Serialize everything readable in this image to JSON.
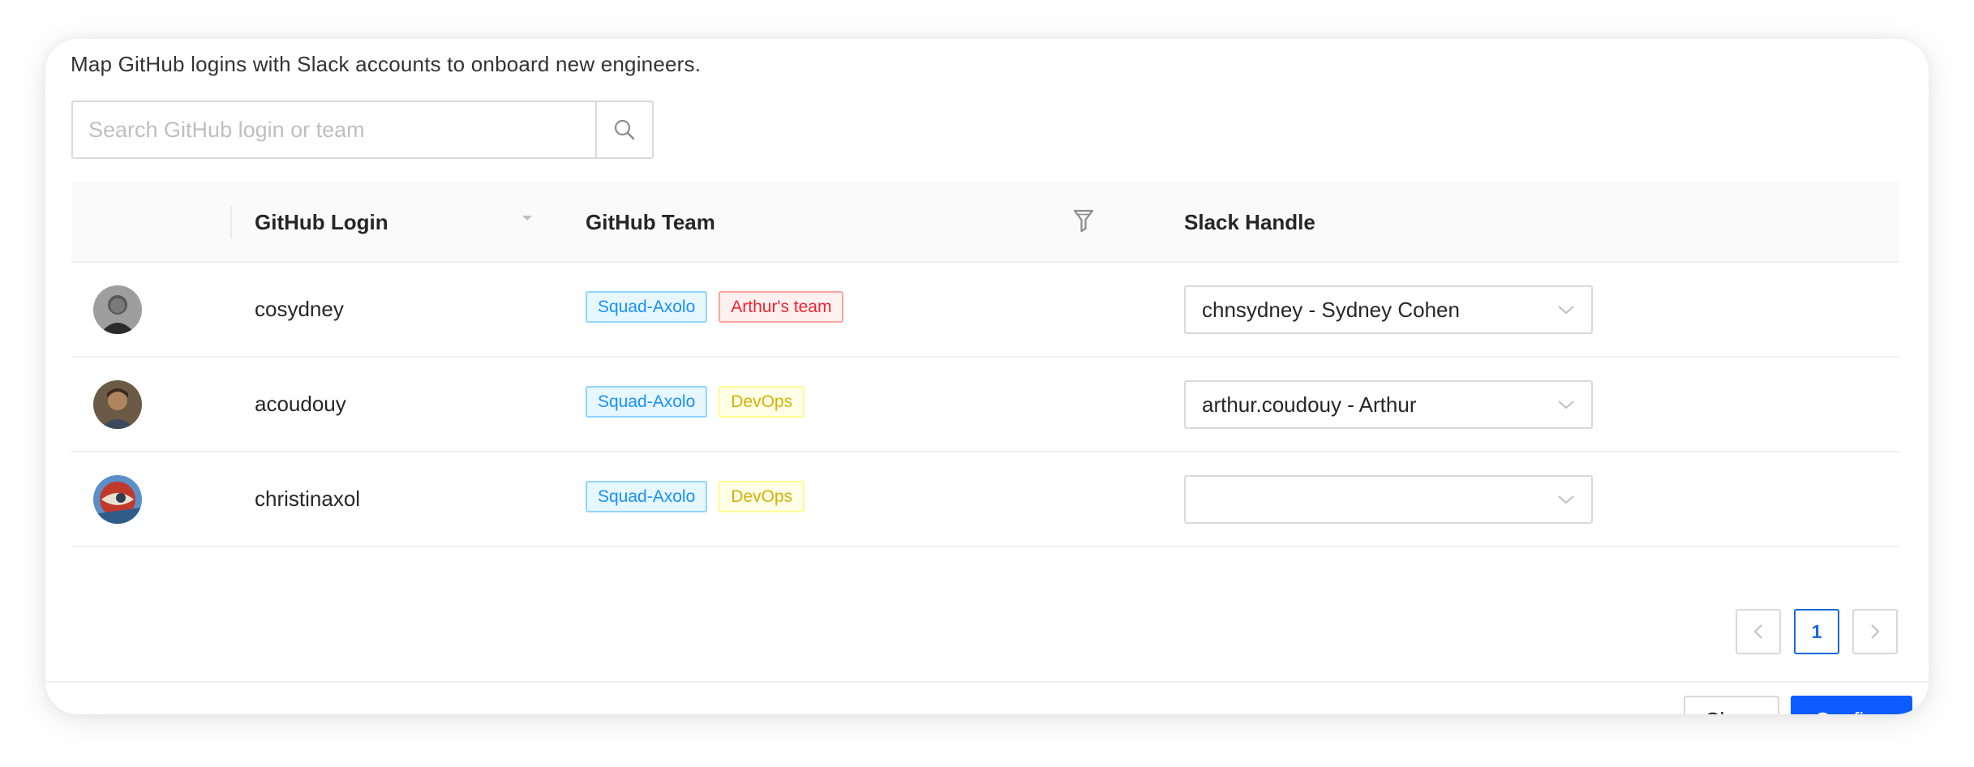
{
  "description": "Map GitHub logins with Slack accounts to onboard new engineers.",
  "search": {
    "placeholder": "Search GitHub login or team",
    "value": ""
  },
  "table": {
    "columns": {
      "login": "GitHub Login",
      "team": "GitHub Team",
      "slack": "Slack Handle"
    },
    "rows": [
      {
        "login": "cosydney",
        "teams": [
          {
            "label": "Squad-Axolo",
            "color": "blue"
          },
          {
            "label": "Arthur's team",
            "color": "red"
          }
        ],
        "slack": "chnsydney - Sydney Cohen"
      },
      {
        "login": "acoudouy",
        "teams": [
          {
            "label": "Squad-Axolo",
            "color": "blue"
          },
          {
            "label": "DevOps",
            "color": "gold"
          }
        ],
        "slack": "arthur.coudouy - Arthur"
      },
      {
        "login": "christinaxol",
        "teams": [
          {
            "label": "Squad-Axolo",
            "color": "blue"
          },
          {
            "label": "DevOps",
            "color": "gold"
          }
        ],
        "slack": ""
      }
    ]
  },
  "pagination": {
    "current": "1"
  },
  "footer": {
    "close": "Close",
    "confirm": "Confirm"
  },
  "colors": {
    "primary": "#0d5cff",
    "tag_blue": "#1890ff",
    "tag_red": "#f5222d",
    "tag_gold": "#d4b106"
  },
  "icons": [
    "search-icon",
    "sort-caret-icon",
    "filter-icon",
    "chevron-down-icon",
    "chevron-left-icon",
    "chevron-right-icon"
  ]
}
